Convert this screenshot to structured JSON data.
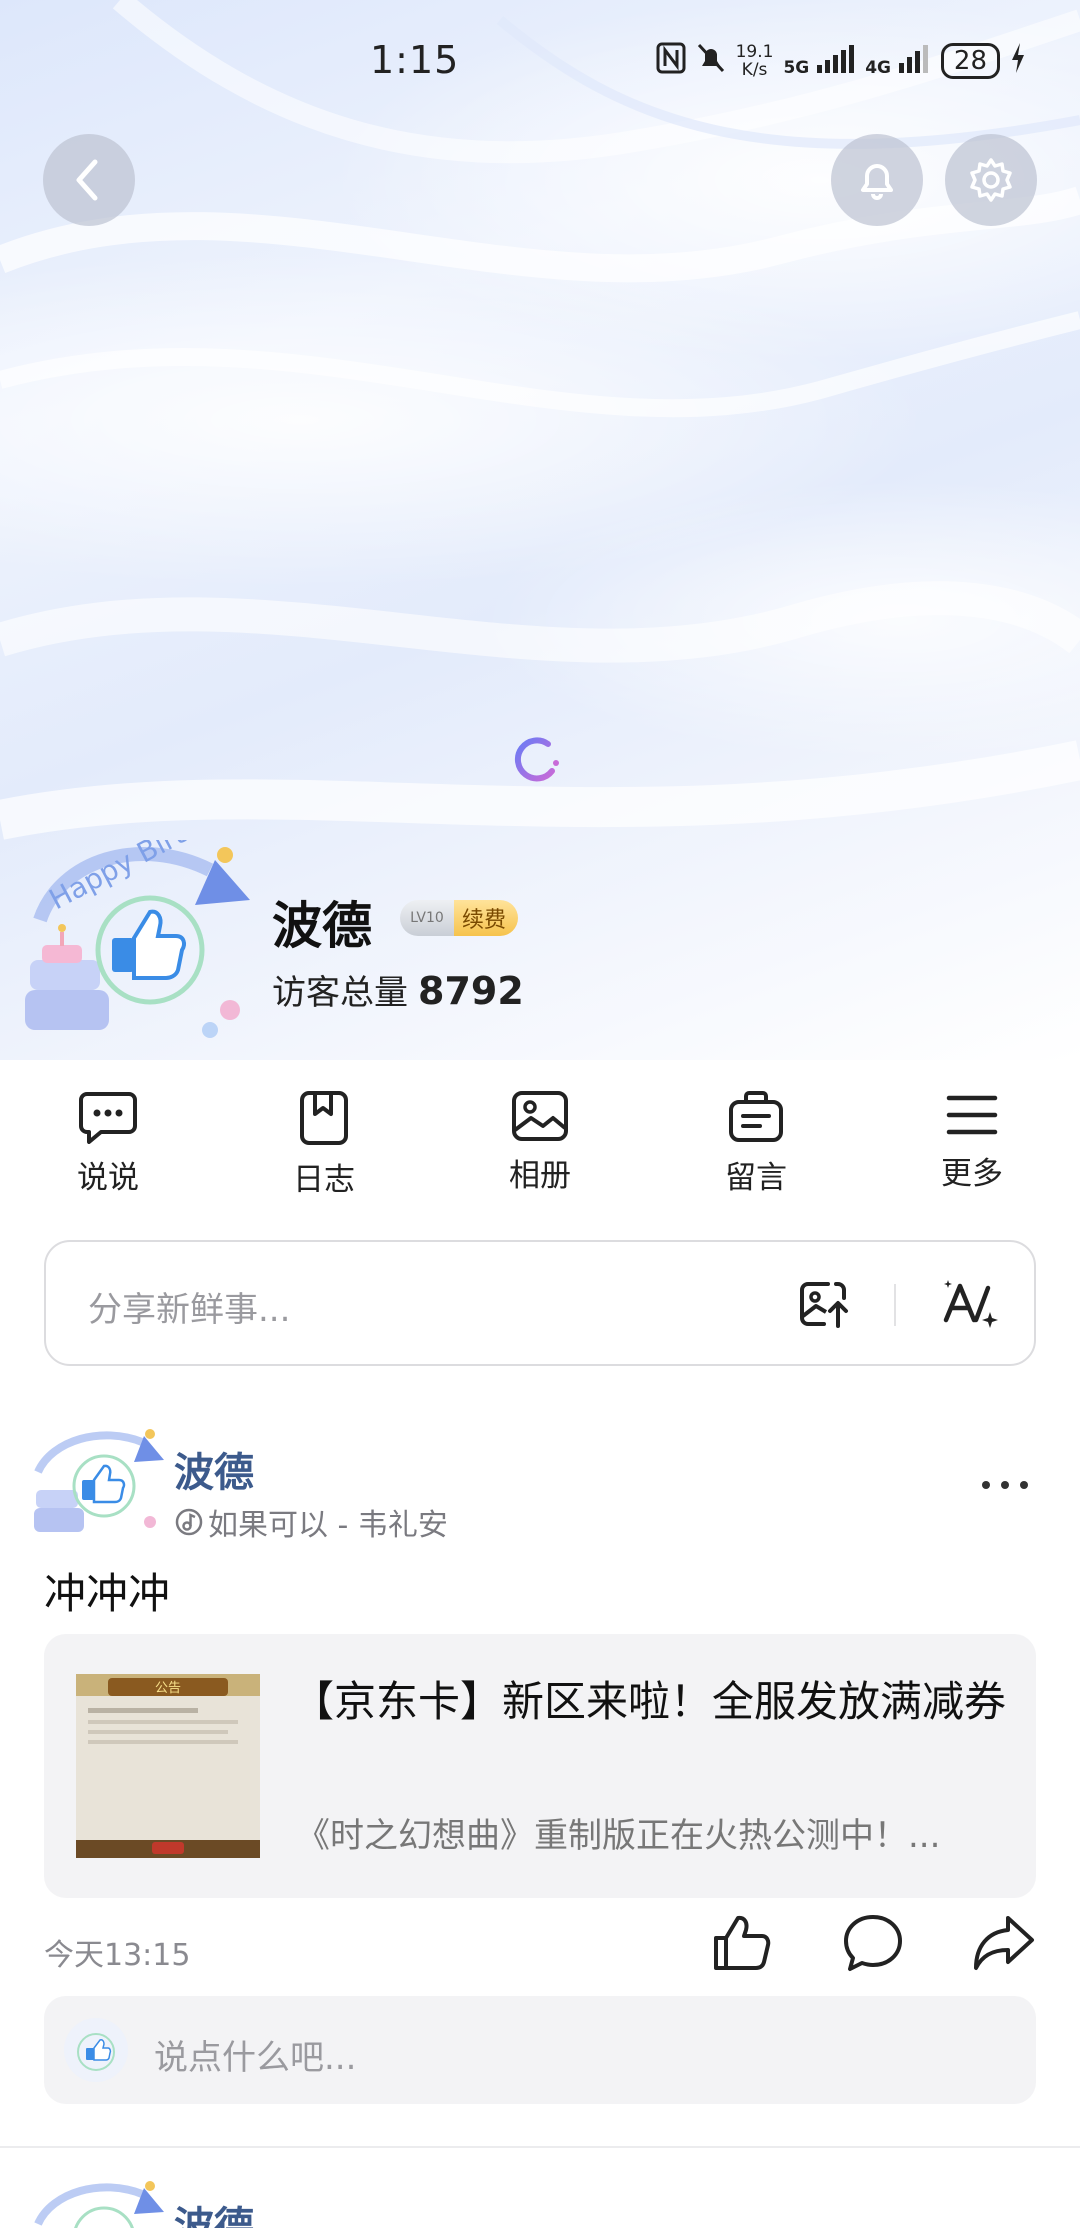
{
  "status_bar": {
    "time": "1:15",
    "net_speed_top": "19.1",
    "net_speed_bottom": "K/s",
    "sig1": "5G",
    "sig2": "4G",
    "battery": "28"
  },
  "profile": {
    "name": "波德",
    "vip_badge": "LV10",
    "renew_label": "续费",
    "visitors_label": "访客总量",
    "visitors_count": "8792"
  },
  "nav": {
    "items": [
      {
        "label": "说说",
        "icon": "chat-bubble-icon"
      },
      {
        "label": "日志",
        "icon": "journal-icon"
      },
      {
        "label": "相册",
        "icon": "album-icon"
      },
      {
        "label": "留言",
        "icon": "message-board-icon"
      },
      {
        "label": "更多",
        "icon": "menu-icon"
      }
    ]
  },
  "share": {
    "placeholder": "分享新鲜事..."
  },
  "post": {
    "author": "波德",
    "music": "如果可以 - 韦礼安",
    "text": "冲冲冲",
    "card_title": "【京东卡】新区来啦！全服发放满减券",
    "card_desc": "《时之幻想曲》重制版正在火热公测中！...",
    "thumb_banner": "公告",
    "time": "今天13:15"
  },
  "comment": {
    "placeholder": "说点什么吧..."
  },
  "next_post": {
    "author": "波德"
  }
}
